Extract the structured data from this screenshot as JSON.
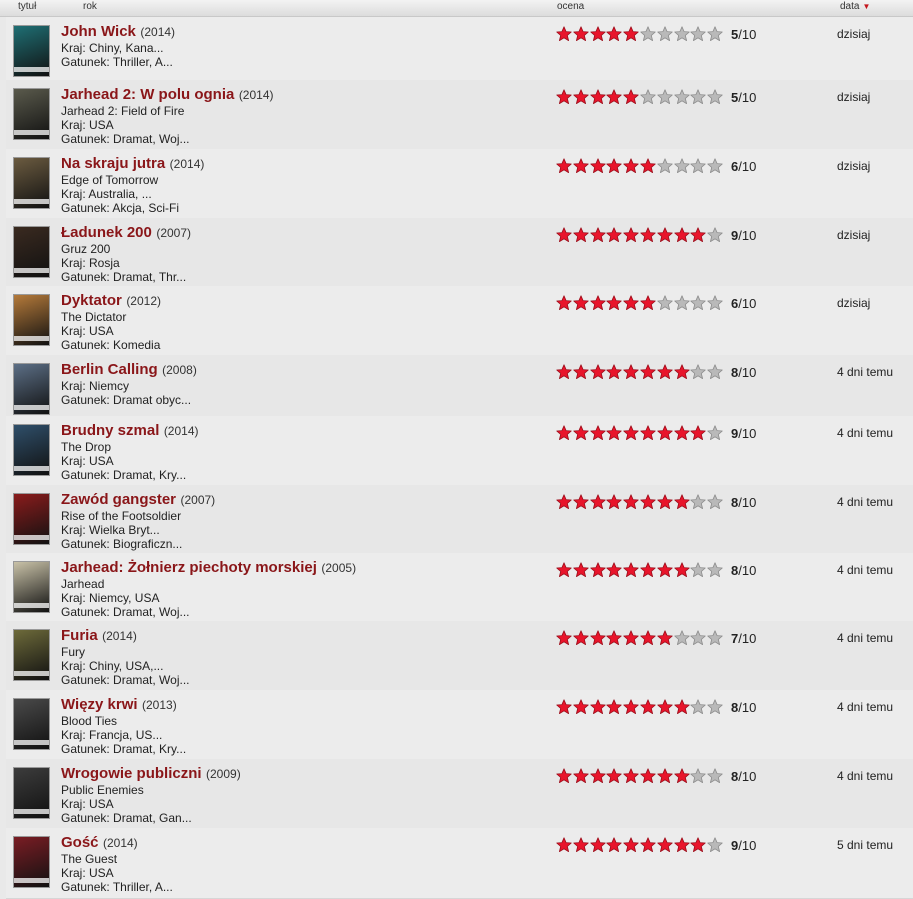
{
  "columns": {
    "title": "tytuł",
    "year": "rok",
    "rating": "ocena",
    "date": "data"
  },
  "colors": {
    "accent": "#8a1619",
    "star_on": "#e8152b",
    "star_off": "#b9b9b9"
  },
  "rows": [
    {
      "title": "John Wick",
      "year": "(2014)",
      "lines": [
        "Kraj: Chiny, Kana...",
        "Gatunek: Thriller, A..."
      ],
      "rating": 5,
      "score_num": "5",
      "score_den": "/10",
      "date": "dzisiaj",
      "poster": "#1f6f74"
    },
    {
      "title": "Jarhead 2: W polu ognia",
      "year": "(2014)",
      "lines": [
        "Jarhead 2: Field of Fire",
        "Kraj: USA",
        "Gatunek: Dramat, Woj..."
      ],
      "rating": 5,
      "score_num": "5",
      "score_den": "/10",
      "date": "dzisiaj",
      "poster": "#5a5a4c"
    },
    {
      "title": "Na skraju jutra",
      "year": "(2014)",
      "lines": [
        "Edge of Tomorrow",
        "Kraj: Australia, ...",
        "Gatunek: Akcja, Sci-Fi"
      ],
      "rating": 6,
      "score_num": "6",
      "score_den": "/10",
      "date": "dzisiaj",
      "poster": "#6b5b40"
    },
    {
      "title": "Ładunek 200",
      "year": "(2007)",
      "lines": [
        "Gruz 200",
        "Kraj: Rosja",
        "Gatunek: Dramat, Thr..."
      ],
      "rating": 9,
      "score_num": "9",
      "score_den": "/10",
      "date": "dzisiaj",
      "poster": "#3a2a20"
    },
    {
      "title": "Dyktator",
      "year": "(2012)",
      "lines": [
        "The Dictator",
        "Kraj: USA",
        "Gatunek: Komedia"
      ],
      "rating": 6,
      "score_num": "6",
      "score_den": "/10",
      "date": "dzisiaj",
      "poster": "#b57a3a"
    },
    {
      "title": "Berlin Calling",
      "year": "(2008)",
      "lines": [
        "Kraj: Niemcy",
        "Gatunek: Dramat obyc..."
      ],
      "rating": 8,
      "score_num": "8",
      "score_den": "/10",
      "date": "4 dni temu",
      "poster": "#5c6f86"
    },
    {
      "title": "Brudny szmal",
      "year": "(2014)",
      "lines": [
        "The Drop",
        "Kraj: USA",
        "Gatunek: Dramat, Kry..."
      ],
      "rating": 9,
      "score_num": "9",
      "score_den": "/10",
      "date": "4 dni temu",
      "poster": "#2f4f6a"
    },
    {
      "title": "Zawód gangster",
      "year": "(2007)",
      "lines": [
        "Rise of the Footsoldier",
        "Kraj: Wielka Bryt...",
        "Gatunek: Biograficzn..."
      ],
      "rating": 8,
      "score_num": "8",
      "score_den": "/10",
      "date": "4 dni temu",
      "poster": "#8a1c1c"
    },
    {
      "title": "Jarhead: Żołnierz piechoty morskiej",
      "year": "(2005)",
      "lines": [
        "Jarhead",
        "Kraj: Niemcy, USA",
        "Gatunek: Dramat, Woj..."
      ],
      "rating": 8,
      "score_num": "8",
      "score_den": "/10",
      "date": "4 dni temu",
      "poster": "#c9c2a8"
    },
    {
      "title": "Furia",
      "year": "(2014)",
      "lines": [
        "Fury",
        "Kraj: Chiny, USA,...",
        "Gatunek: Dramat, Woj..."
      ],
      "rating": 7,
      "score_num": "7",
      "score_den": "/10",
      "date": "4 dni temu",
      "poster": "#6d6a3a"
    },
    {
      "title": "Więzy krwi",
      "year": "(2013)",
      "lines": [
        "Blood Ties",
        "Kraj: Francja, US...",
        "Gatunek: Dramat, Kry..."
      ],
      "rating": 8,
      "score_num": "8",
      "score_den": "/10",
      "date": "4 dni temu",
      "poster": "#4a4a4a"
    },
    {
      "title": "Wrogowie publiczni",
      "year": "(2009)",
      "lines": [
        "Public Enemies",
        "Kraj: USA",
        "Gatunek: Dramat, Gan..."
      ],
      "rating": 8,
      "score_num": "8",
      "score_den": "/10",
      "date": "4 dni temu",
      "poster": "#3c3c3c"
    },
    {
      "title": "Gość",
      "year": "(2014)",
      "lines": [
        "The Guest",
        "Kraj: USA",
        "Gatunek: Thriller, A..."
      ],
      "rating": 9,
      "score_num": "9",
      "score_den": "/10",
      "date": "5 dni temu",
      "poster": "#7a1d24"
    }
  ]
}
